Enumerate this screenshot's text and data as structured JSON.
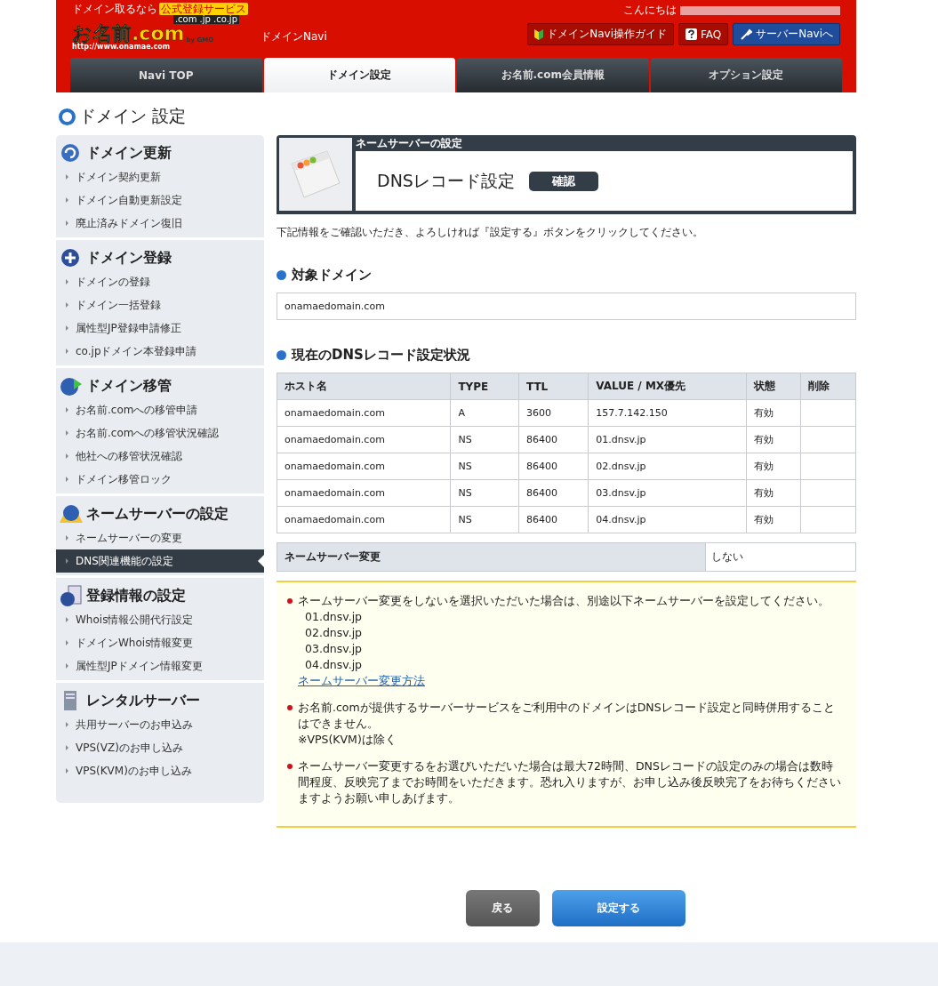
{
  "header": {
    "logo_tagline": "ドメイン取るなら",
    "logo_badge": "公式登録サービス",
    "logo_tlds": ".com .jp .co.jp",
    "logo_name": "お名前.com",
    "logo_url": "http://www.onamae.com",
    "logo_by": "by GMO",
    "app_name": "ドメインNavi",
    "greeting": "こんにちは",
    "links": [
      {
        "label": "ドメインNavi操作ガイド",
        "kind": "guide"
      },
      {
        "label": "FAQ",
        "kind": "faq"
      },
      {
        "label": "サーバーNaviへ",
        "kind": "server"
      }
    ]
  },
  "tabs": [
    {
      "label": "Navi TOP",
      "selected": false
    },
    {
      "label": "ドメイン設定",
      "selected": true
    },
    {
      "label": "お名前.com会員情報",
      "selected": false
    },
    {
      "label": "オプション設定",
      "selected": false
    }
  ],
  "page_title": "ドメイン 設定",
  "sidebar": [
    {
      "title": "ドメイン更新",
      "kind": "renew",
      "items": [
        {
          "label": "ドメイン契約更新",
          "selected": false
        },
        {
          "label": "ドメイン自動更新設定",
          "selected": false
        },
        {
          "label": "廃止済みドメイン復旧",
          "selected": false
        }
      ]
    },
    {
      "title": "ドメイン登録",
      "kind": "add",
      "items": [
        {
          "label": "ドメインの登録",
          "selected": false
        },
        {
          "label": "ドメイン一括登録",
          "selected": false
        },
        {
          "label": "属性型JP登録申請修正",
          "selected": false
        },
        {
          "label": "co.jpドメイン本登録申請",
          "selected": false
        }
      ]
    },
    {
      "title": "ドメイン移管",
      "kind": "transfer",
      "items": [
        {
          "label": "お名前.comへの移管申請",
          "selected": false
        },
        {
          "label": "お名前.comへの移管状況確認",
          "selected": false
        },
        {
          "label": "他社への移管状況確認",
          "selected": false
        },
        {
          "label": "ドメイン移管ロック",
          "selected": false
        }
      ]
    },
    {
      "title": "ネームサーバーの設定",
      "kind": "nameserver",
      "items": [
        {
          "label": "ネームサーバーの変更",
          "selected": false
        },
        {
          "label": "DNS関連機能の設定",
          "selected": true
        }
      ]
    },
    {
      "title": "登録情報の設定",
      "kind": "info",
      "items": [
        {
          "label": "Whois情報公開代行設定",
          "selected": false
        },
        {
          "label": "ドメインWhois情報変更",
          "selected": false
        },
        {
          "label": "属性型JPドメイン情報変更",
          "selected": false
        }
      ]
    },
    {
      "title": "レンタルサーバー",
      "kind": "server",
      "items": [
        {
          "label": "共用サーバーのお申込み",
          "selected": false
        },
        {
          "label": "VPS(VZ)のお申し込み",
          "selected": false
        },
        {
          "label": "VPS(KVM)のお申し込み",
          "selected": false
        }
      ]
    }
  ],
  "panel": {
    "category": "ネームサーバーの設定",
    "title": "DNSレコード設定",
    "step": "確認"
  },
  "instruction": "下記情報をご確認いただき、よろしければ『設定する』ボタンをクリックしてください。",
  "target_heading": "対象ドメイン",
  "target_domain": "onamaedomain.com",
  "records_heading": "現在のDNSレコード設定状況",
  "table": {
    "columns": [
      "ホスト名",
      "TYPE",
      "TTL",
      "VALUE / MX優先",
      "状態",
      "削除"
    ],
    "rows": [
      [
        "onamaedomain.com",
        "A",
        "3600",
        "157.7.142.150",
        "有効",
        ""
      ],
      [
        "onamaedomain.com",
        "NS",
        "86400",
        "01.dnsv.jp",
        "有効",
        ""
      ],
      [
        "onamaedomain.com",
        "NS",
        "86400",
        "02.dnsv.jp",
        "有効",
        ""
      ],
      [
        "onamaedomain.com",
        "NS",
        "86400",
        "03.dnsv.jp",
        "有効",
        ""
      ],
      [
        "onamaedomain.com",
        "NS",
        "86400",
        "04.dnsv.jp",
        "有効",
        ""
      ]
    ]
  },
  "ns_change": {
    "label": "ネームサーバー変更",
    "value": "しない"
  },
  "notes": [
    {
      "text": "ネームサーバー変更をしないを選択いただいた場合は、別途以下ネームサーバーを設定してください。",
      "servers": [
        "01.dnsv.jp",
        "02.dnsv.jp",
        "03.dnsv.jp",
        "04.dnsv.jp"
      ],
      "link": "ネームサーバー変更方法"
    },
    {
      "text": "お名前.comが提供するサーバーサービスをご利用中のドメインはDNSレコード設定と同時併用することはできません。",
      "sub": "※VPS(KVM)は除く"
    },
    {
      "text": "ネームサーバー変更するをお選びいただいた場合は最大72時間、DNSレコードの設定のみの場合は数時間程度、反映完了までお時間をいただきます。恐れ入りますが、お申し込み後反映完了をお待ちくださいますようお願い申しあげます。"
    }
  ],
  "buttons": {
    "back": "戻る",
    "submit": "設定する"
  }
}
